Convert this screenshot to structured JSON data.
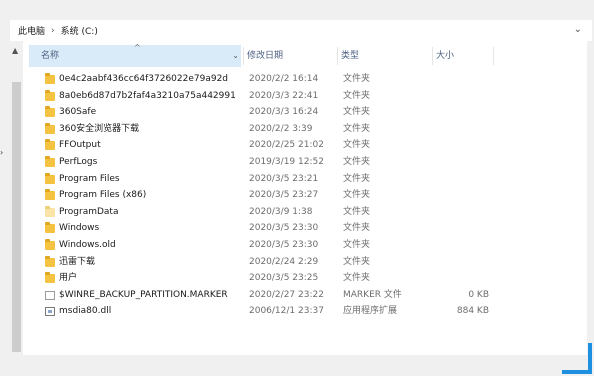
{
  "breadcrumb": {
    "root": "此电脑",
    "separator": "›",
    "current": "系统 (C:)",
    "dropdown_icon": "chevron-down-icon"
  },
  "columns": {
    "name": "名称",
    "date": "修改日期",
    "type": "类型",
    "size": "大小"
  },
  "files": [
    {
      "name": "0e4c2aabf436cc64f3726022e79a92d",
      "date": "2020/2/2 16:14",
      "type": "文件夹",
      "size": "",
      "icon": "folder-icon"
    },
    {
      "name": "8a0eb6d87d7b2faf4a3210a75a442991",
      "date": "2020/3/3 22:41",
      "type": "文件夹",
      "size": "",
      "icon": "folder-icon"
    },
    {
      "name": "360Safe",
      "date": "2020/3/3 16:24",
      "type": "文件夹",
      "size": "",
      "icon": "folder-icon"
    },
    {
      "name": "360安全浏览器下载",
      "date": "2020/2/2 3:39",
      "type": "文件夹",
      "size": "",
      "icon": "folder-icon"
    },
    {
      "name": "FFOutput",
      "date": "2020/2/25 21:02",
      "type": "文件夹",
      "size": "",
      "icon": "folder-icon"
    },
    {
      "name": "PerfLogs",
      "date": "2019/3/19 12:52",
      "type": "文件夹",
      "size": "",
      "icon": "folder-icon"
    },
    {
      "name": "Program Files",
      "date": "2020/3/5 23:21",
      "type": "文件夹",
      "size": "",
      "icon": "folder-icon"
    },
    {
      "name": "Program Files (x86)",
      "date": "2020/3/5 23:27",
      "type": "文件夹",
      "size": "",
      "icon": "folder-icon"
    },
    {
      "name": "ProgramData",
      "date": "2020/3/9 1:38",
      "type": "文件夹",
      "size": "",
      "icon": "folder-light-icon"
    },
    {
      "name": "Windows",
      "date": "2020/3/5 23:30",
      "type": "文件夹",
      "size": "",
      "icon": "folder-icon"
    },
    {
      "name": "Windows.old",
      "date": "2020/3/5 23:30",
      "type": "文件夹",
      "size": "",
      "icon": "folder-icon"
    },
    {
      "name": "迅雷下载",
      "date": "2020/2/24 2:29",
      "type": "文件夹",
      "size": "",
      "icon": "folder-icon"
    },
    {
      "name": "用户",
      "date": "2020/3/5 23:25",
      "type": "文件夹",
      "size": "",
      "icon": "folder-icon"
    },
    {
      "name": "$WINRE_BACKUP_PARTITION.MARKER",
      "date": "2020/2/27 23:22",
      "type": "MARKER 文件",
      "size": "0 KB",
      "icon": "file-icon"
    },
    {
      "name": "msdia80.dll",
      "date": "2006/12/1 23:37",
      "type": "应用程序扩展",
      "size": "884 KB",
      "icon": "dll-icon"
    }
  ],
  "colors": {
    "header_highlight": "#d9ebf9",
    "folder": "#f5c342",
    "accent": "#1e90e0"
  }
}
